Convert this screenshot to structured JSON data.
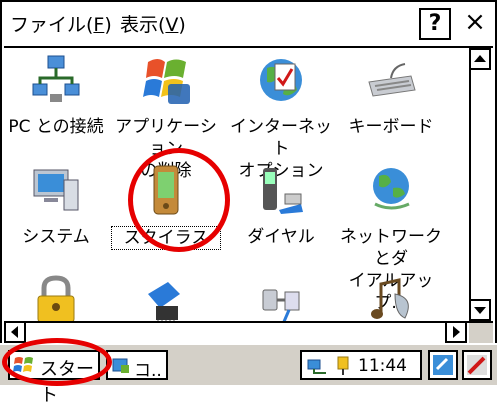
{
  "menu": {
    "file": "ファイル(",
    "file_key": "F",
    "file_end": ")",
    "view": "表示(",
    "view_key": "V",
    "view_end": ")",
    "help_label": "?",
    "close_label": "×"
  },
  "items": [
    {
      "label": "PC との接続",
      "icon": "pc-connection-icon"
    },
    {
      "label": "アプリケーション\nの削除",
      "icon": "remove-programs-icon"
    },
    {
      "label": "インターネット\nオプション",
      "icon": "internet-options-icon"
    },
    {
      "label": "キーボード",
      "icon": "keyboard-icon"
    },
    {
      "label": "システム",
      "icon": "system-icon"
    },
    {
      "label": "スタイラス",
      "icon": "stylus-icon"
    },
    {
      "label": "ダイヤル",
      "icon": "dialing-icon"
    },
    {
      "label": "ネットワークとダ\nイアルアップ...",
      "icon": "network-dialup-icon"
    },
    {
      "label": "",
      "icon": "owner-password-icon"
    },
    {
      "label": "",
      "icon": "storage-manager-icon"
    },
    {
      "label": "",
      "icon": "power-icon"
    },
    {
      "label": "",
      "icon": "volume-sounds-icon"
    }
  ],
  "taskbar": {
    "start_label": "スタート",
    "task_label": "コ..",
    "clock": "11:44"
  },
  "colors": {
    "highlight_circle": "#e60000",
    "taskbar_bg": "#d4d0c8"
  }
}
